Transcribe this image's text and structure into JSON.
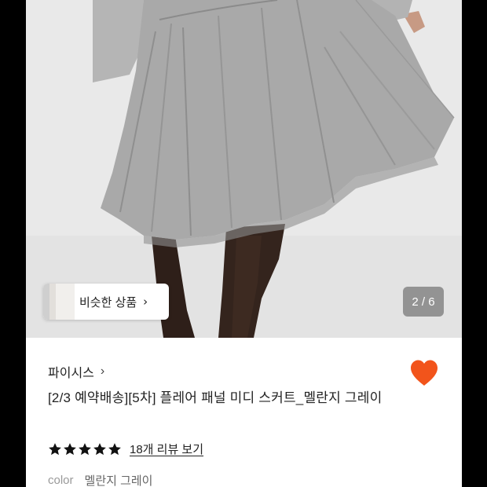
{
  "product_image": {
    "alt": "",
    "similar_button": {
      "label": "비슷한 상품",
      "chevron": "chevron-right-icon"
    },
    "page_counter": "2 / 6"
  },
  "product_info": {
    "brand": "파이시스",
    "brand_chevron": "chevron-right-icon",
    "title": "[2/3 예약배송][5차] 플레어 패널 미디 스커트_멜란지 그레이",
    "rating": {
      "stars": 5,
      "review_link": "18개 리뷰 보기"
    },
    "color_label": "color",
    "color_value": "멜란지 그레이",
    "like_icon": "heart-icon"
  },
  "colors": {
    "accent": "#f2541b",
    "background": "#ffffff",
    "frame": "#000000",
    "skirt": "#a9a9a9",
    "tights": "#2e1f19"
  }
}
